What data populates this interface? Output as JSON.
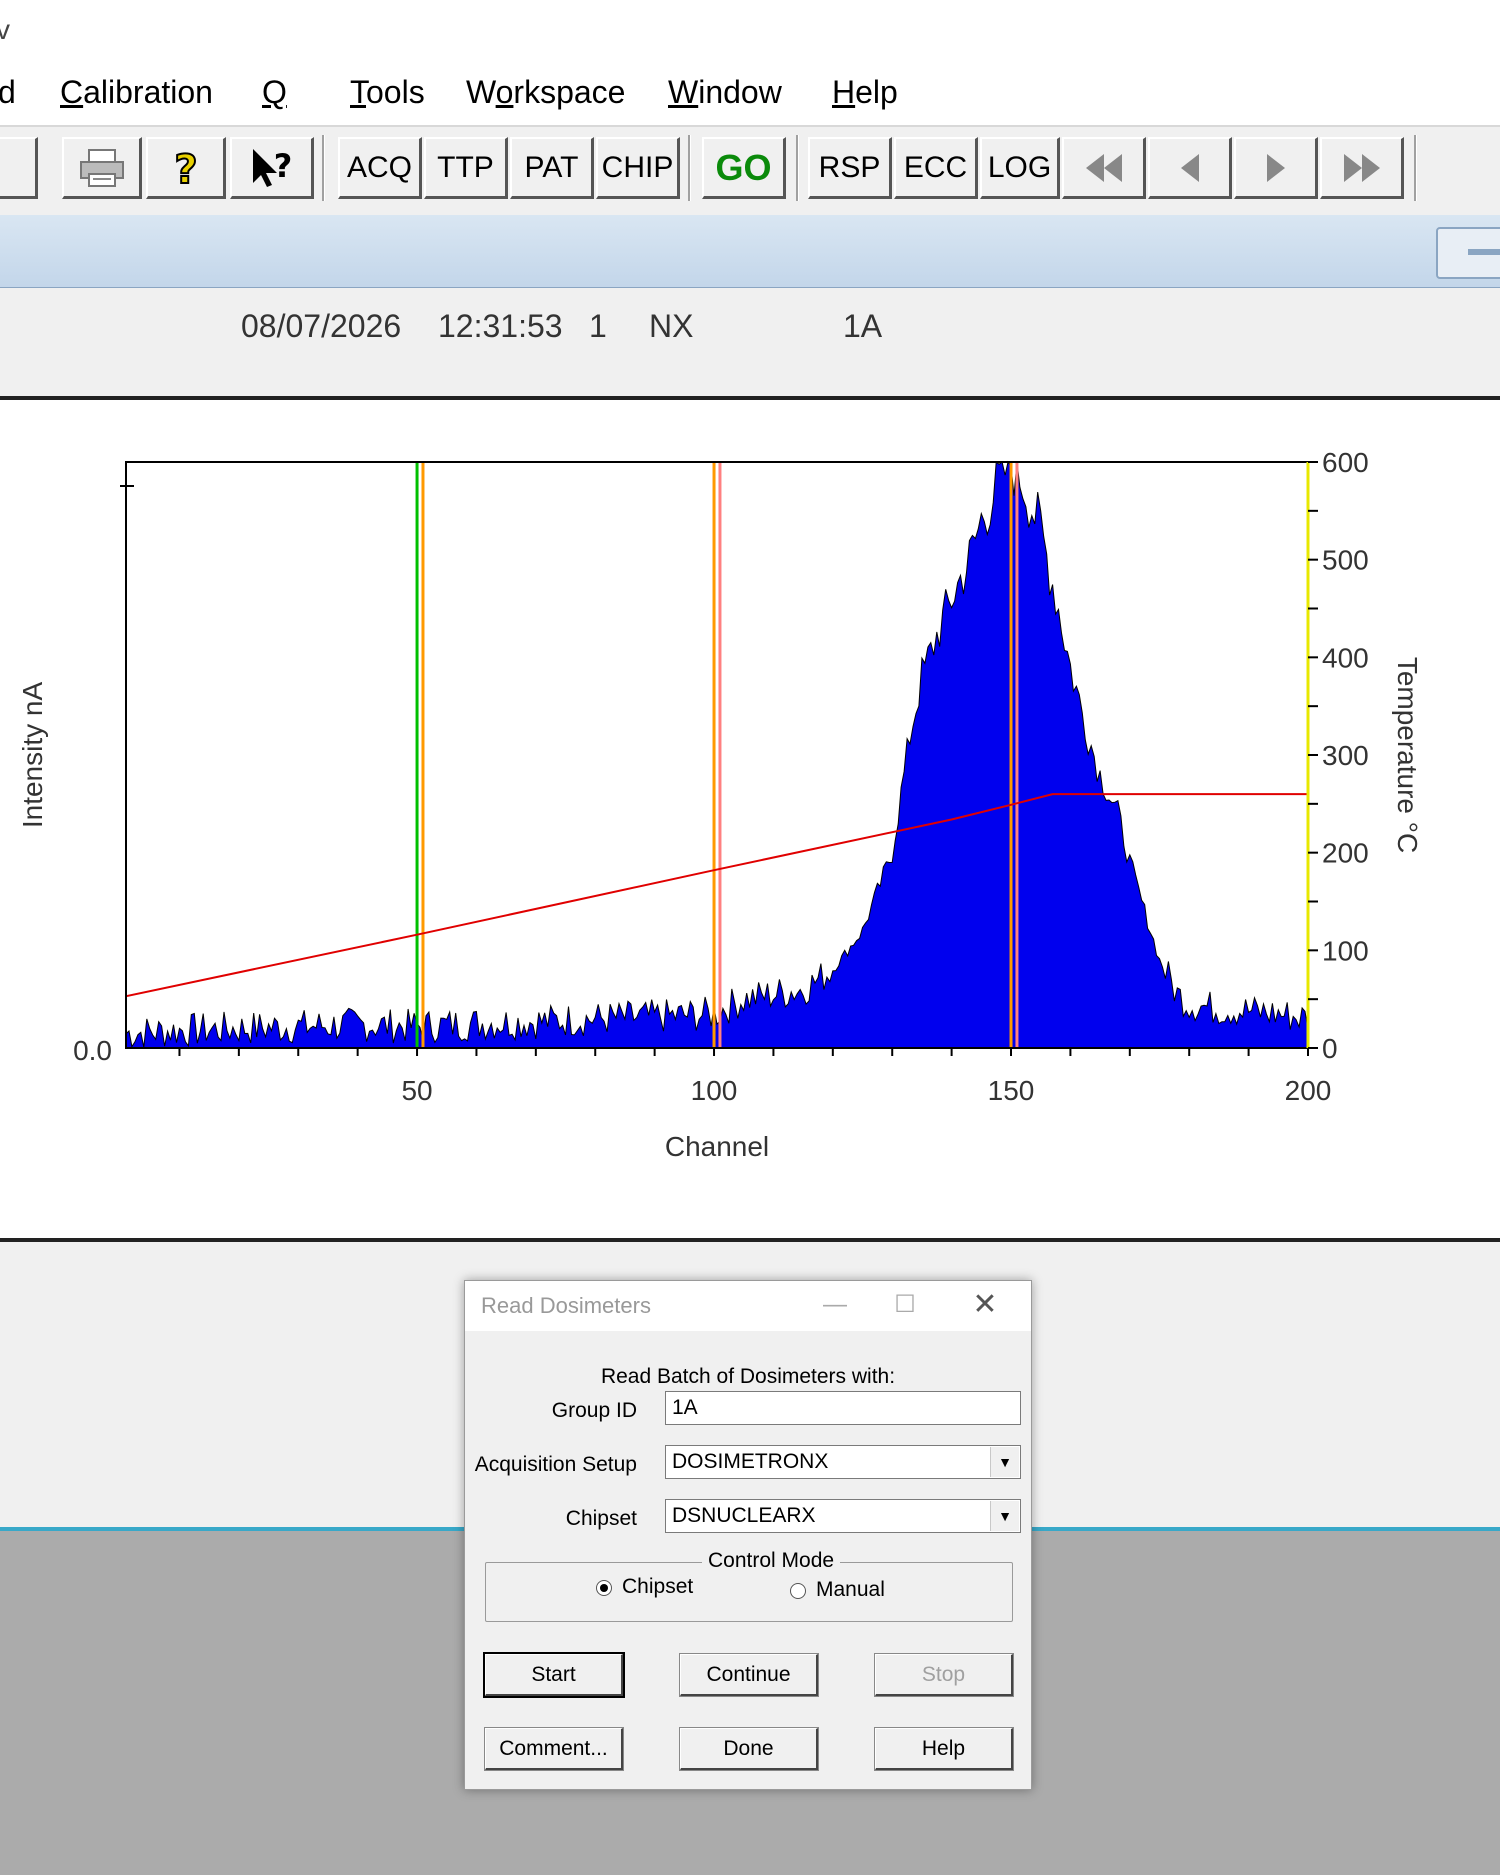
{
  "window": {
    "title_fragment": "v"
  },
  "menu": {
    "items": [
      {
        "label": "d"
      },
      {
        "label": "Calibration",
        "accel": "C"
      },
      {
        "label": "QC",
        "accel": "Q"
      },
      {
        "label": "Tools",
        "accel": "T"
      },
      {
        "label": "Workspace",
        "accel": "o"
      },
      {
        "label": "Window",
        "accel": "W"
      },
      {
        "label": "Help",
        "accel": "H"
      }
    ]
  },
  "toolbar": {
    "buttons": [
      {
        "name": "acq-button",
        "label": "ACQ"
      },
      {
        "name": "ttp-button",
        "label": "TTP"
      },
      {
        "name": "pat-button",
        "label": "PAT"
      },
      {
        "name": "chip-button",
        "label": "CHIP"
      },
      {
        "name": "go-button",
        "label": "GO"
      },
      {
        "name": "rsp-button",
        "label": "RSP"
      },
      {
        "name": "ecc-button",
        "label": "ECC"
      },
      {
        "name": "log-button",
        "label": "LOG"
      }
    ],
    "icons": [
      "printer-icon",
      "help-icon",
      "context-help-icon",
      "first-record-icon",
      "previous-record-icon",
      "next-record-icon",
      "last-record-icon"
    ]
  },
  "record_info": {
    "date": "08/07/2026",
    "time": "12:31:53",
    "number": "1",
    "code": "NX",
    "group": "1A"
  },
  "chart_data": {
    "type": "area",
    "xlabel": "Channel",
    "ylabel": "Intensity nA",
    "y2label": "Temperature °C",
    "xlim": [
      1,
      200
    ],
    "ylim_label_min": "0.0",
    "y2lim": [
      0,
      600
    ],
    "x_ticks": [
      "50",
      "100",
      "150",
      "200"
    ],
    "y_ticks": [
      "0.0"
    ],
    "y2_ticks": [
      "0",
      "100",
      "200",
      "300",
      "400",
      "500",
      "600"
    ],
    "series": [
      {
        "kind": "glow-curve",
        "color": "#0000ee",
        "x": [
          1,
          10,
          20,
          30,
          40,
          50,
          60,
          70,
          80,
          90,
          100,
          105,
          110,
          115,
          120,
          125,
          130,
          133,
          135,
          138,
          140,
          143,
          145,
          148,
          150,
          152,
          155,
          158,
          160,
          163,
          165,
          168,
          170,
          173,
          175,
          178,
          180,
          185,
          190,
          195,
          200
        ],
        "y_temperature_scale": [
          15,
          18,
          20,
          22,
          24,
          22,
          25,
          27,
          30,
          32,
          35,
          50,
          55,
          60,
          80,
          120,
          200,
          320,
          380,
          430,
          460,
          500,
          540,
          580,
          600,
          580,
          530,
          450,
          390,
          320,
          280,
          240,
          190,
          130,
          90,
          55,
          45,
          40,
          38,
          35,
          30
        ]
      },
      {
        "kind": "temperature",
        "color": "#e00000",
        "x": [
          1,
          50,
          100,
          140,
          150,
          157,
          200
        ],
        "y": [
          53,
          116,
          182,
          234,
          249,
          260,
          260
        ]
      }
    ],
    "markers": [
      {
        "x": 50,
        "color": "#00c000"
      },
      {
        "x": 51,
        "color": "#ff9900"
      },
      {
        "x": 100,
        "color": "#ff9900"
      },
      {
        "x": 101,
        "color": "#ff8080"
      },
      {
        "x": 150,
        "color": "#ff9900"
      },
      {
        "x": 151,
        "color": "#ff8080"
      }
    ],
    "grid": false
  },
  "dialog": {
    "title": "Read Dosimeters",
    "heading": "Read Batch of Dosimeters with:",
    "group_id_label": "Group ID",
    "group_id_value": "1A",
    "acq_setup_label": "Acquisition Setup",
    "acq_setup_value": "DOSIMETRONX",
    "chipset_label": "Chipset",
    "chipset_value": "DSNUCLEARX",
    "control_mode_label": "Control Mode",
    "mode_chipset": "Chipset",
    "mode_manual": "Manual",
    "selected_mode": "Chipset",
    "buttons": {
      "start": "Start",
      "continue": "Continue",
      "stop": "Stop",
      "comment": "Comment...",
      "done": "Done",
      "help": "Help"
    }
  }
}
